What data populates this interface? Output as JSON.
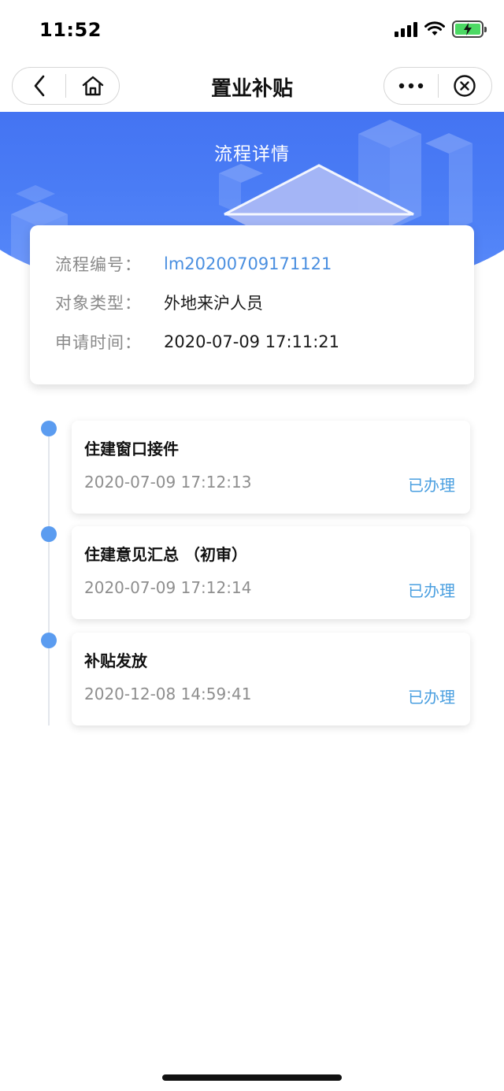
{
  "status_bar": {
    "time": "11:52",
    "icons": [
      "signal-icon",
      "wifi-icon",
      "battery-charging-icon"
    ]
  },
  "nav": {
    "title": "置业补贴",
    "left_icons": [
      "back-chevron-icon",
      "home-icon"
    ],
    "right_icons": [
      "more-dots-icon",
      "close-circle-icon"
    ]
  },
  "banner": {
    "title": "流程详情",
    "gradient_colors": [
      "#3f6df0",
      "#5a8cfa"
    ]
  },
  "info": {
    "rows": [
      {
        "label": "流程编号：",
        "value": "lm20200709171121"
      },
      {
        "label": "对象类型：",
        "value": "外地来沪人员"
      },
      {
        "label": "申请时间：",
        "value": "2020-07-09 17:11:21"
      }
    ]
  },
  "timeline": {
    "steps": [
      {
        "title": "住建窗口接件",
        "time": "2020-07-09 17:12:13",
        "status": "已办理"
      },
      {
        "title": "住建意见汇总 （初审）",
        "time": "2020-07-09 17:12:14",
        "status": "已办理"
      },
      {
        "title": "补贴发放",
        "time": "2020-12-08 14:59:41",
        "status": "已办理"
      }
    ]
  },
  "colors": {
    "accent_blue": "#4a8fe0",
    "dot_blue": "#5b9cf0",
    "status_blue": "#4a9fe0",
    "muted_text": "#8e8e8e"
  }
}
